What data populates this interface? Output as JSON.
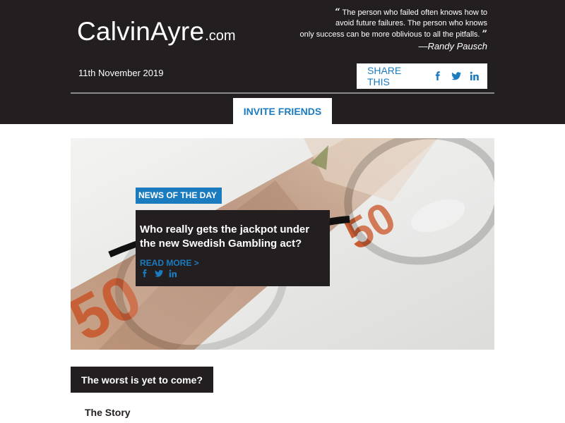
{
  "header": {
    "logo": {
      "name": "CalvinAyre",
      "tld": ".com"
    },
    "quote": {
      "open_mark": "“",
      "close_mark": "”",
      "line1": "The person who failed often knows how to",
      "line2": "avoid future failures. The person who knows",
      "line3": "only success can be more oblivious to all the pitfalls.",
      "author": "—Randy Pausch"
    },
    "date": "11th November 2019",
    "share": {
      "label": "SHARE THIS",
      "icons": [
        "facebook-icon",
        "twitter-icon",
        "linkedin-icon"
      ]
    },
    "invite_label": "INVITE FRIENDS"
  },
  "feature": {
    "badge": "NEWS OF THE DAY",
    "title": "Who really gets the jackpot under the new Swedish Gambling act?",
    "read_more": "READ MORE >",
    "icons": [
      "facebook-icon",
      "twitter-icon",
      "linkedin-icon"
    ]
  },
  "section": {
    "title": "The worst is yet to come?",
    "story_label": "The Story"
  },
  "colors": {
    "header_bg": "#231f20",
    "accent_blue": "#1b7bbf",
    "divider": "#8a8a8a",
    "banknote_orange": "#c8552a"
  }
}
